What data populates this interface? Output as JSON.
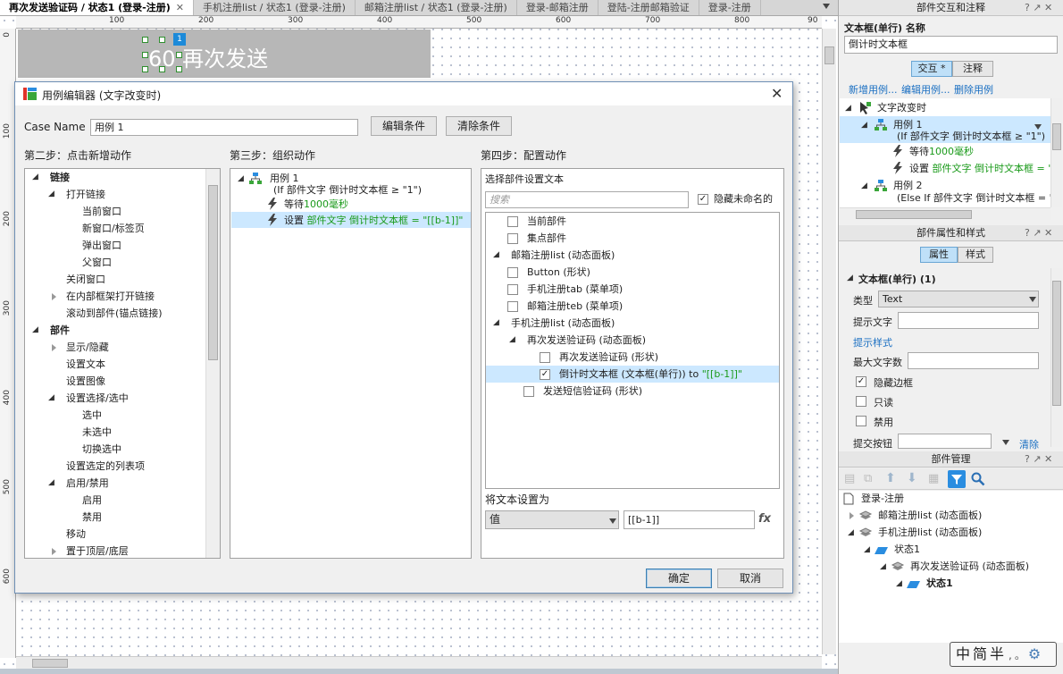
{
  "tabs": [
    {
      "label": "再次发送验证码 / 状态1 (登录-注册)",
      "active": true
    },
    {
      "label": "手机注册list / 状态1 (登录-注册)"
    },
    {
      "label": "邮箱注册list / 状态1 (登录-注册)"
    },
    {
      "label": "登录-邮箱注册"
    },
    {
      "label": "登陆-注册邮箱验证"
    },
    {
      "label": "登录-注册"
    }
  ],
  "ruler": {
    "h": [
      "100",
      "200",
      "300",
      "400",
      "500",
      "600",
      "700",
      "800",
      "90"
    ],
    "v": [
      "0",
      "100",
      "200",
      "300",
      "400",
      "500",
      "600"
    ]
  },
  "canvas": {
    "widget_text": "60 再次发送",
    "badge": "1"
  },
  "dialog": {
    "title": "用例编辑器 (文字改变时)",
    "case_name_label": "Case Name",
    "case_name_value": "用例 1",
    "edit_condition": "编辑条件",
    "clear_condition": "清除条件",
    "step2": "第二步：点击新增动作",
    "step3": "第三步：组织动作",
    "step4": "第四步：配置动作",
    "actions": {
      "links": "链接",
      "open_link": "打开链接",
      "current_window": "当前窗口",
      "new_window": "新窗口/标签页",
      "popup": "弹出窗口",
      "parent_window": "父窗口",
      "close_window": "关闭窗口",
      "open_in_frame": "在内部框架打开链接",
      "scroll_to": "滚动到部件(锚点链接)",
      "widgets": "部件",
      "show_hide": "显示/隐藏",
      "set_text": "设置文本",
      "set_image": "设置图像",
      "set_selected": "设置选择/选中",
      "selected": "选中",
      "unselected": "未选中",
      "toggle_selected": "切换选中",
      "set_list": "设置选定的列表项",
      "enable_disable": "启用/禁用",
      "enable": "启用",
      "disable": "禁用",
      "move": "移动",
      "bring_front": "置于顶层/底层"
    },
    "organize": {
      "case": "用例 1",
      "condition": "(If 部件文字 倒计时文本框 ≥ \"1\")",
      "wait_prefix": "等待",
      "wait_value": "1000毫秒",
      "set_prefix": "设置",
      "set_value": "部件文字 倒计时文本框 = \"[[b-1]]\""
    },
    "config": {
      "select_label": "选择部件设置文本",
      "search_placeholder": "搜索",
      "hide_unnamed": "隐藏未命名的",
      "items": {
        "current_widget": "当前部件",
        "focus_widget": "集点部件",
        "email_list": "邮箱注册list (动态面板)",
        "button_shape": "Button (形状)",
        "phone_tab": "手机注册tab (菜单项)",
        "email_teb": "邮箱注册teb (菜单项)",
        "phone_list": "手机注册list (动态面板)",
        "resend_panel": "再次发送验证码 (动态面板)",
        "resend_shape": "再次发送验证码 (形状)",
        "countdown_prefix": "倒计时文本框 (文本框(单行)) to ",
        "countdown_value": "\"[[b-1]]\"",
        "send_sms": "发送短信验证码 (形状)"
      },
      "set_to_label": "将文本设置为",
      "type_value": "值",
      "value_input": "[[b-1]]",
      "fx": "fx"
    },
    "ok": "确定",
    "cancel": "取消"
  },
  "interaction_panel": {
    "title": "部件交互和注释",
    "widget_type": "文本框(单行)",
    "name_label": "名称",
    "name_value": "倒计时文本框",
    "tab_interaction": "交互 *",
    "tab_notes": "注释",
    "new_case": "新增用例...",
    "edit_case": "编辑用例...",
    "delete_case": "删除用例",
    "event": "文字改变时",
    "case1": "用例 1",
    "case1_condition": "(If 部件文字 倒计时文本框 ≥ \"1\")",
    "wait_prefix": "等待",
    "wait_value": "1000毫秒",
    "set_prefix": "设置",
    "set_value": "部件文字 倒计时文本框 = \"",
    "case2": "用例 2",
    "case2_condition": "(Else If 部件文字 倒计时文本框 = \""
  },
  "props_panel": {
    "title": "部件属性和样式",
    "tab_props": "属性",
    "tab_style": "样式",
    "section": "文本框(单行) (1)",
    "type_label": "类型",
    "type_value": "Text",
    "hint_label": "提示文字",
    "hint_style": "提示样式",
    "max_label": "最大文字数",
    "hide_border": "隐藏边框",
    "readonly": "只读",
    "disabled": "禁用",
    "submit_label": "提交按钮",
    "clear": "清除"
  },
  "manager_panel": {
    "title": "部件管理",
    "page": "登录-注册",
    "email_list": "邮箱注册list (动态面板)",
    "phone_list": "手机注册list (动态面板)",
    "state1": "状态1",
    "resend_panel": "再次发送验证码 (动态面板)",
    "state1b": "状态1"
  },
  "ime": {
    "text": "中简半"
  },
  "colors": {
    "accent": "#1a6fc2",
    "green": "#1a9a1a",
    "highlight": "#cce8ff"
  }
}
